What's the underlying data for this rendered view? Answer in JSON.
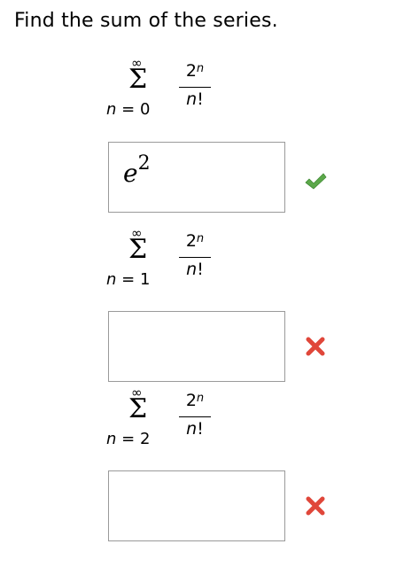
{
  "question": {
    "prompt": "Find the sum of the series."
  },
  "problems": [
    {
      "upper_limit": "∞",
      "sigma": "Σ",
      "lower_var": "n",
      "lower_eq": " = ",
      "lower_value": "0",
      "numerator_base": "2",
      "numerator_exp": "n",
      "denominator_var": "n",
      "denominator_fact": "!",
      "answer": {
        "base": "e",
        "exp": "2"
      },
      "status": "correct",
      "status_icon": "check-icon",
      "status_color": "#5ca84a"
    },
    {
      "upper_limit": "∞",
      "sigma": "Σ",
      "lower_var": "n",
      "lower_eq": " = ",
      "lower_value": "1",
      "numerator_base": "2",
      "numerator_exp": "n",
      "denominator_var": "n",
      "denominator_fact": "!",
      "answer": {
        "base": "",
        "exp": ""
      },
      "status": "incorrect",
      "status_icon": "x-mark-icon",
      "status_color": "#e0473a"
    },
    {
      "upper_limit": "∞",
      "sigma": "Σ",
      "lower_var": "n",
      "lower_eq": " = ",
      "lower_value": "2",
      "numerator_base": "2",
      "numerator_exp": "n",
      "denominator_var": "n",
      "denominator_fact": "!",
      "answer": {
        "base": "",
        "exp": ""
      },
      "status": "incorrect",
      "status_icon": "x-mark-icon",
      "status_color": "#e0473a"
    }
  ]
}
